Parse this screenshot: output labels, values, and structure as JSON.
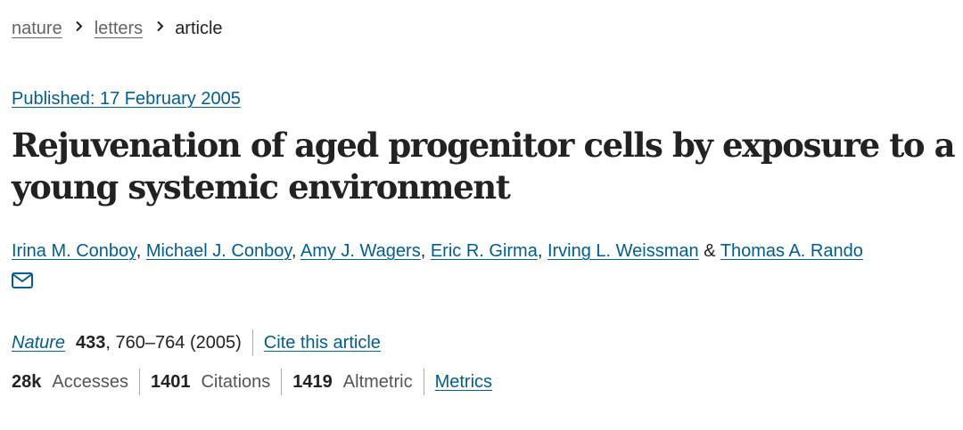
{
  "breadcrumb": {
    "items": [
      {
        "label": "nature"
      },
      {
        "label": "letters"
      },
      {
        "label": "article"
      }
    ]
  },
  "article": {
    "published": "Published: 17 February 2005",
    "title": "Rejuvenation of aged progenitor cells by exposure to a young systemic environment",
    "authors": [
      "Irina M. Conboy",
      "Michael J. Conboy",
      "Amy J. Wagers",
      "Eric R. Girma",
      "Irving L. Weissman",
      "Thomas A. Rando"
    ],
    "author_separator": ", ",
    "author_last_joiner": " & ",
    "contact_icon": "envelope-icon",
    "journal": {
      "name": "Nature",
      "volume": "433",
      "pages_year": ", 760–764 (2005)",
      "cite_label": "Cite this article"
    },
    "metrics": {
      "accesses_value": "28k",
      "accesses_label": "Accesses",
      "citations_value": "1401",
      "citations_label": "Citations",
      "altmetric_value": "1419",
      "altmetric_label": "Altmetric",
      "metrics_link": "Metrics"
    }
  },
  "colors": {
    "link": "#025e8d",
    "text": "#222222",
    "muted": "#555555",
    "separator": "#aaaaaa"
  }
}
